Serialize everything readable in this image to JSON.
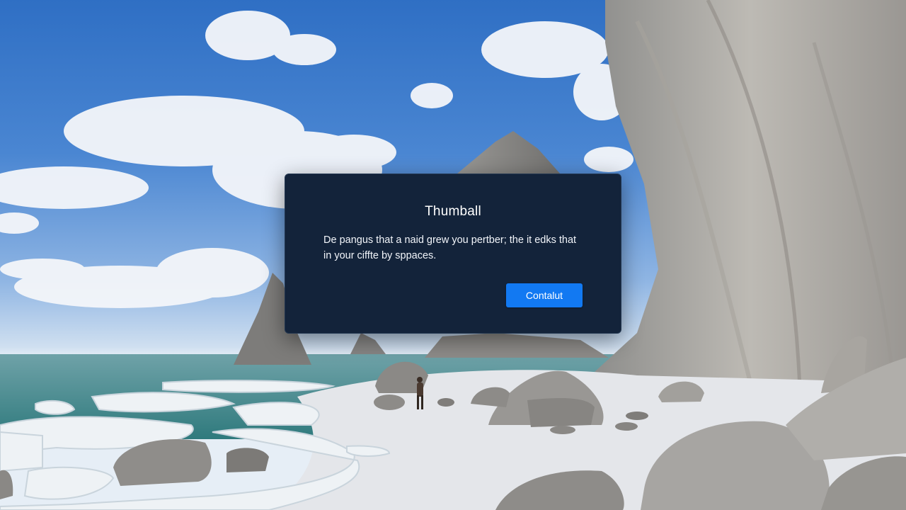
{
  "dialog": {
    "title": "Thumball",
    "message_line1": "De pangus that a naid grew you pertber; the it edks that",
    "message_line2": "in your ciffte by sppaces.",
    "button_label": "Contalut"
  },
  "colors": {
    "dialog_background": "#13233a",
    "button_accent": "#1279f2",
    "sky": "#3a78c9"
  }
}
